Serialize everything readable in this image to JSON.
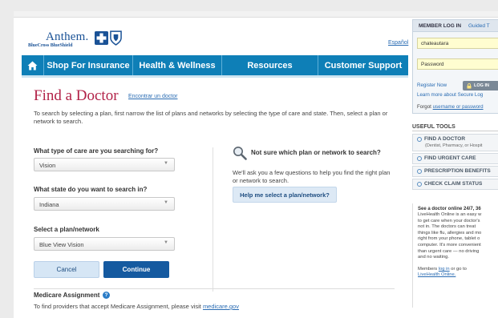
{
  "brand": {
    "name": "Anthem.",
    "sub": "BlueCross BlueShield",
    "blue": "#1a5296"
  },
  "espanol_link": "Español",
  "nav": {
    "home_icon": "home-icon",
    "items": [
      "Shop For Insurance",
      "Health & Wellness",
      "Resources",
      "Customer Support"
    ],
    "color": "#0e7fb7"
  },
  "main": {
    "title": "Find a Doctor",
    "title_link": "Encontrar un doctor",
    "intro": "To search by selecting a plan, first narrow the list of plans and networks by selecting the type of care and state. Then, select a plan or network to search.",
    "care_question": "What type of care are you searching for?",
    "care_value": "Vision",
    "state_question": "What state do you want to search in?",
    "state_value": "Indiana",
    "plan_question": "Select a plan/network",
    "plan_value": "Blue View Vision",
    "not_sure_title": "Not sure which plan or network to search?",
    "help_text": "We'll ask you a few questions to help you find the right plan or network to search.",
    "help_button": "Help me select a plan/network?",
    "cancel_button": "Cancel",
    "continue_button": "Continue",
    "medicare_title": "Medicare Assignment",
    "medicare_text": "To find providers that accept Medicare Assignment, please visit ",
    "medicare_link": "medicare.gov",
    "title_color": "#b22248"
  },
  "sidebar": {
    "member_title": "MEMBER LOG IN",
    "guided_link": "Guided T",
    "username_value": "chateautara",
    "password_value": "Password",
    "register_link": "Register Now",
    "login_button": "LOG IN",
    "learn_link": "Learn more about Secure Log",
    "forgot_text": "Forgot ",
    "forgot_link": "username or password",
    "tools_title": "USEFUL TOOLS",
    "tools": [
      {
        "label": "FIND A DOCTOR",
        "sub": "(Dentist, Pharmacy, or Hospit"
      },
      {
        "label": "FIND URGENT CARE"
      },
      {
        "label": "PRESCRIPTION BENEFITS"
      },
      {
        "label": "CHECK CLAIM STATUS"
      }
    ],
    "promo_title": "See a doctor online 24/7, 36",
    "promo_lines": [
      "LiveHealth Online is an easy w",
      "to get care when your doctor's",
      "not in. The doctors can treat",
      "things like flu, allergies and mo",
      "right from your phone, tablet o",
      "computer. It's more convenient",
      "than urgent care — no driving",
      "and no waiting."
    ],
    "promo_foot_1": "Members ",
    "promo_foot_login": "log in",
    "promo_foot_2": " or go to",
    "promo_foot_link": "LiveHealth Online."
  }
}
